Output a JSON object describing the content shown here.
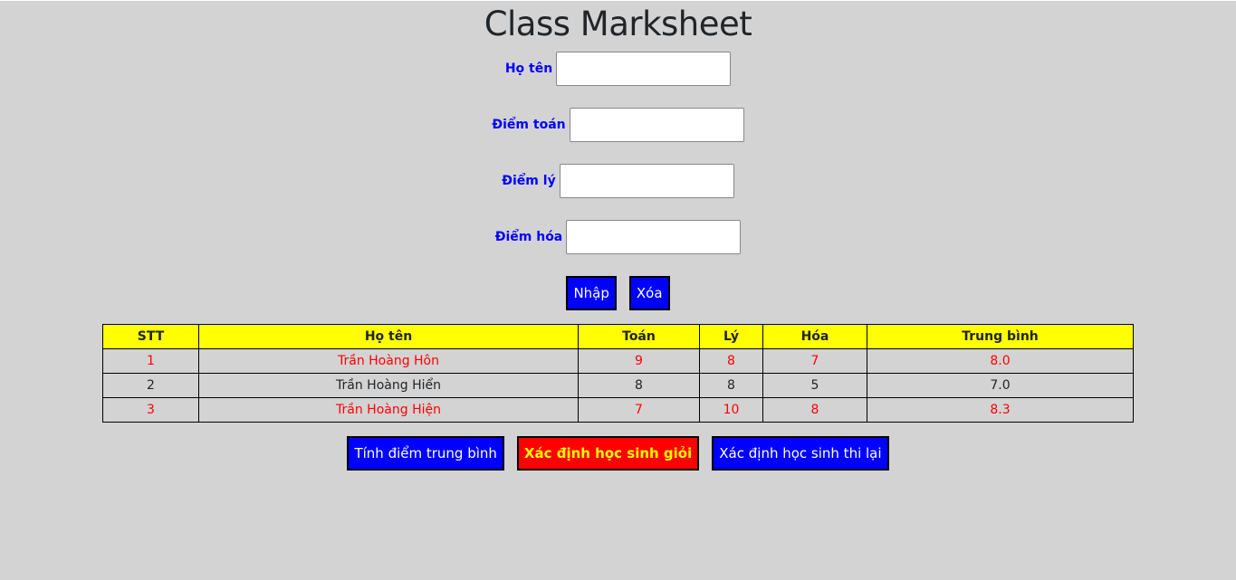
{
  "title": "Class Marksheet",
  "form": {
    "fields": [
      {
        "label": "Họ tên",
        "value": ""
      },
      {
        "label": "Điểm toán",
        "value": ""
      },
      {
        "label": "Điểm lý",
        "value": ""
      },
      {
        "label": "Điểm hóa",
        "value": ""
      }
    ],
    "submit": "Nhập",
    "clear": "Xóa"
  },
  "table": {
    "headers": [
      "STT",
      "Họ tên",
      "Toán",
      "Lý",
      "Hóa",
      "Trung bình"
    ],
    "rows": [
      {
        "cells": [
          "1",
          "Trần Hoàng Hôn",
          "9",
          "8",
          "7",
          "8.0"
        ],
        "highlight": true
      },
      {
        "cells": [
          "2",
          "Trần Hoàng Hiển",
          "8",
          "8",
          "5",
          "7.0"
        ],
        "highlight": false
      },
      {
        "cells": [
          "3",
          "Trần Hoàng Hiện",
          "7",
          "10",
          "8",
          "8.3"
        ],
        "highlight": true
      }
    ]
  },
  "actions": {
    "average": "Tính điểm trung bình",
    "excellent": "Xác định học sinh giỏi",
    "retake": "Xác định học sinh thi lại"
  },
  "colors": {
    "highlight_row": "#ff0000",
    "header_bg": "#ffff00",
    "button": "#0000ff",
    "excellent_button": "#ff0000"
  }
}
